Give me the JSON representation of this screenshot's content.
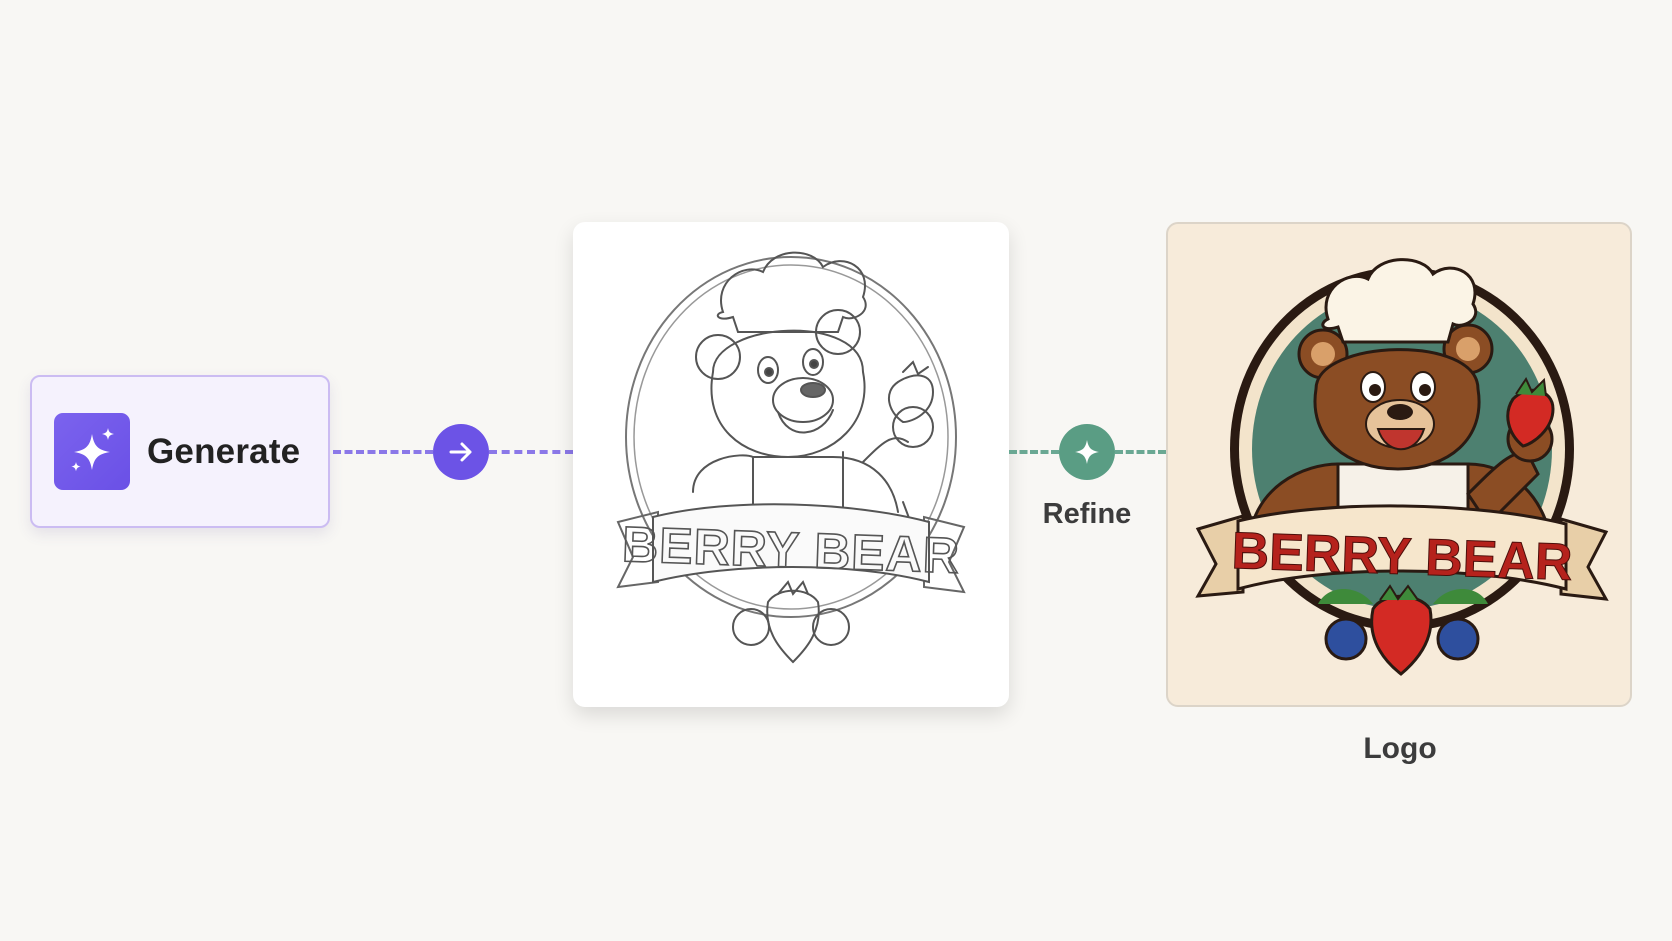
{
  "generate": {
    "label": "Generate",
    "icon": "sparkle-icon",
    "accent": "#6c53e6"
  },
  "connector_1": {
    "icon": "arrow-right-icon",
    "color": "#6c53e6"
  },
  "sketch": {
    "banner_text": "BERRY BEAR"
  },
  "connector_2": {
    "icon": "sparkle-icon",
    "label": "Refine",
    "color": "#5a9d84"
  },
  "logo": {
    "banner_text": "BERRY BEAR",
    "label": "Logo",
    "text_color": "#b5221c"
  }
}
